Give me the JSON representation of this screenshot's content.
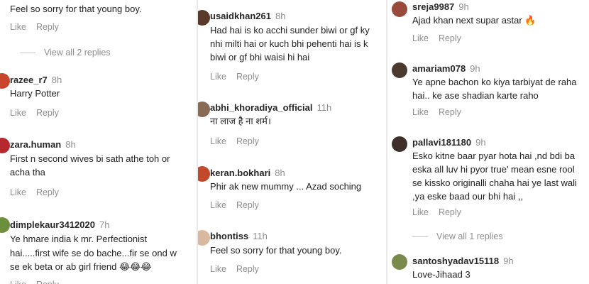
{
  "actions": {
    "like": "Like",
    "reply": "Reply"
  },
  "col1": {
    "top_text": "Feel so sorry for that young boy.",
    "view_all": "View all 2 replies",
    "comments": [
      {
        "user": "razee_r7",
        "time": "8h",
        "lines": [
          "Harry Potter"
        ]
      },
      {
        "user": "zara.human",
        "time": "8h",
        "lines": [
          "First n second wives bi sath athe toh or",
          "acha tha"
        ]
      },
      {
        "user": "dimplekaur3412020",
        "time": "7h",
        "lines": [
          "Ye hmare india k mr. Perfectionist",
          "hai.....first wife se do bache...fir se ond w",
          "se ek beta or ab girl friend"
        ],
        "emoji": "😂😂😂"
      }
    ]
  },
  "col2": {
    "comments": [
      {
        "user": "usaidkhan261",
        "time": "8h",
        "lines": [
          "Had hai is ko acchi sunder biwi or gf ky",
          "nhi milti hai or kuch bhi pehenti hai is k",
          "biwi or gf bhi waisi hi hai"
        ]
      },
      {
        "user": "abhi_khoradiya_official",
        "time": "11h",
        "lines": [
          "ना लाज है ना शर्म।"
        ]
      },
      {
        "user": "keran.bokhari",
        "time": "8h",
        "lines": [
          "Phir ak new mummy ... Azad soching"
        ]
      },
      {
        "user": "bhontiss",
        "time": "11h",
        "lines": [
          "Feel so sorry for that young boy."
        ]
      }
    ]
  },
  "col3": {
    "view_all": "View all 1 replies",
    "comments": [
      {
        "user": "sreja9987",
        "time": "9h",
        "lines": [
          "Ajad khan next supar astar"
        ],
        "emoji": "🔥"
      },
      {
        "user": "amariam078",
        "time": "9h",
        "lines": [
          "Ye apne bachon ko kiya tarbiyat de raha",
          "hai.. ke ase shadian karte raho"
        ]
      },
      {
        "user": "pallavi181180",
        "time": "9h",
        "lines": [
          "Esko kitne baar pyar hota hai ,nd bdi ba",
          "eska all luv hi pyor true' mean esne rool",
          "se kissko originalli chaha hai ye last wali",
          ",ya eske baad our bhi hai ,,"
        ]
      },
      {
        "user": "santoshyadav15118",
        "time": "9h",
        "lines": [
          "Love-Jihaad 3"
        ]
      }
    ]
  }
}
